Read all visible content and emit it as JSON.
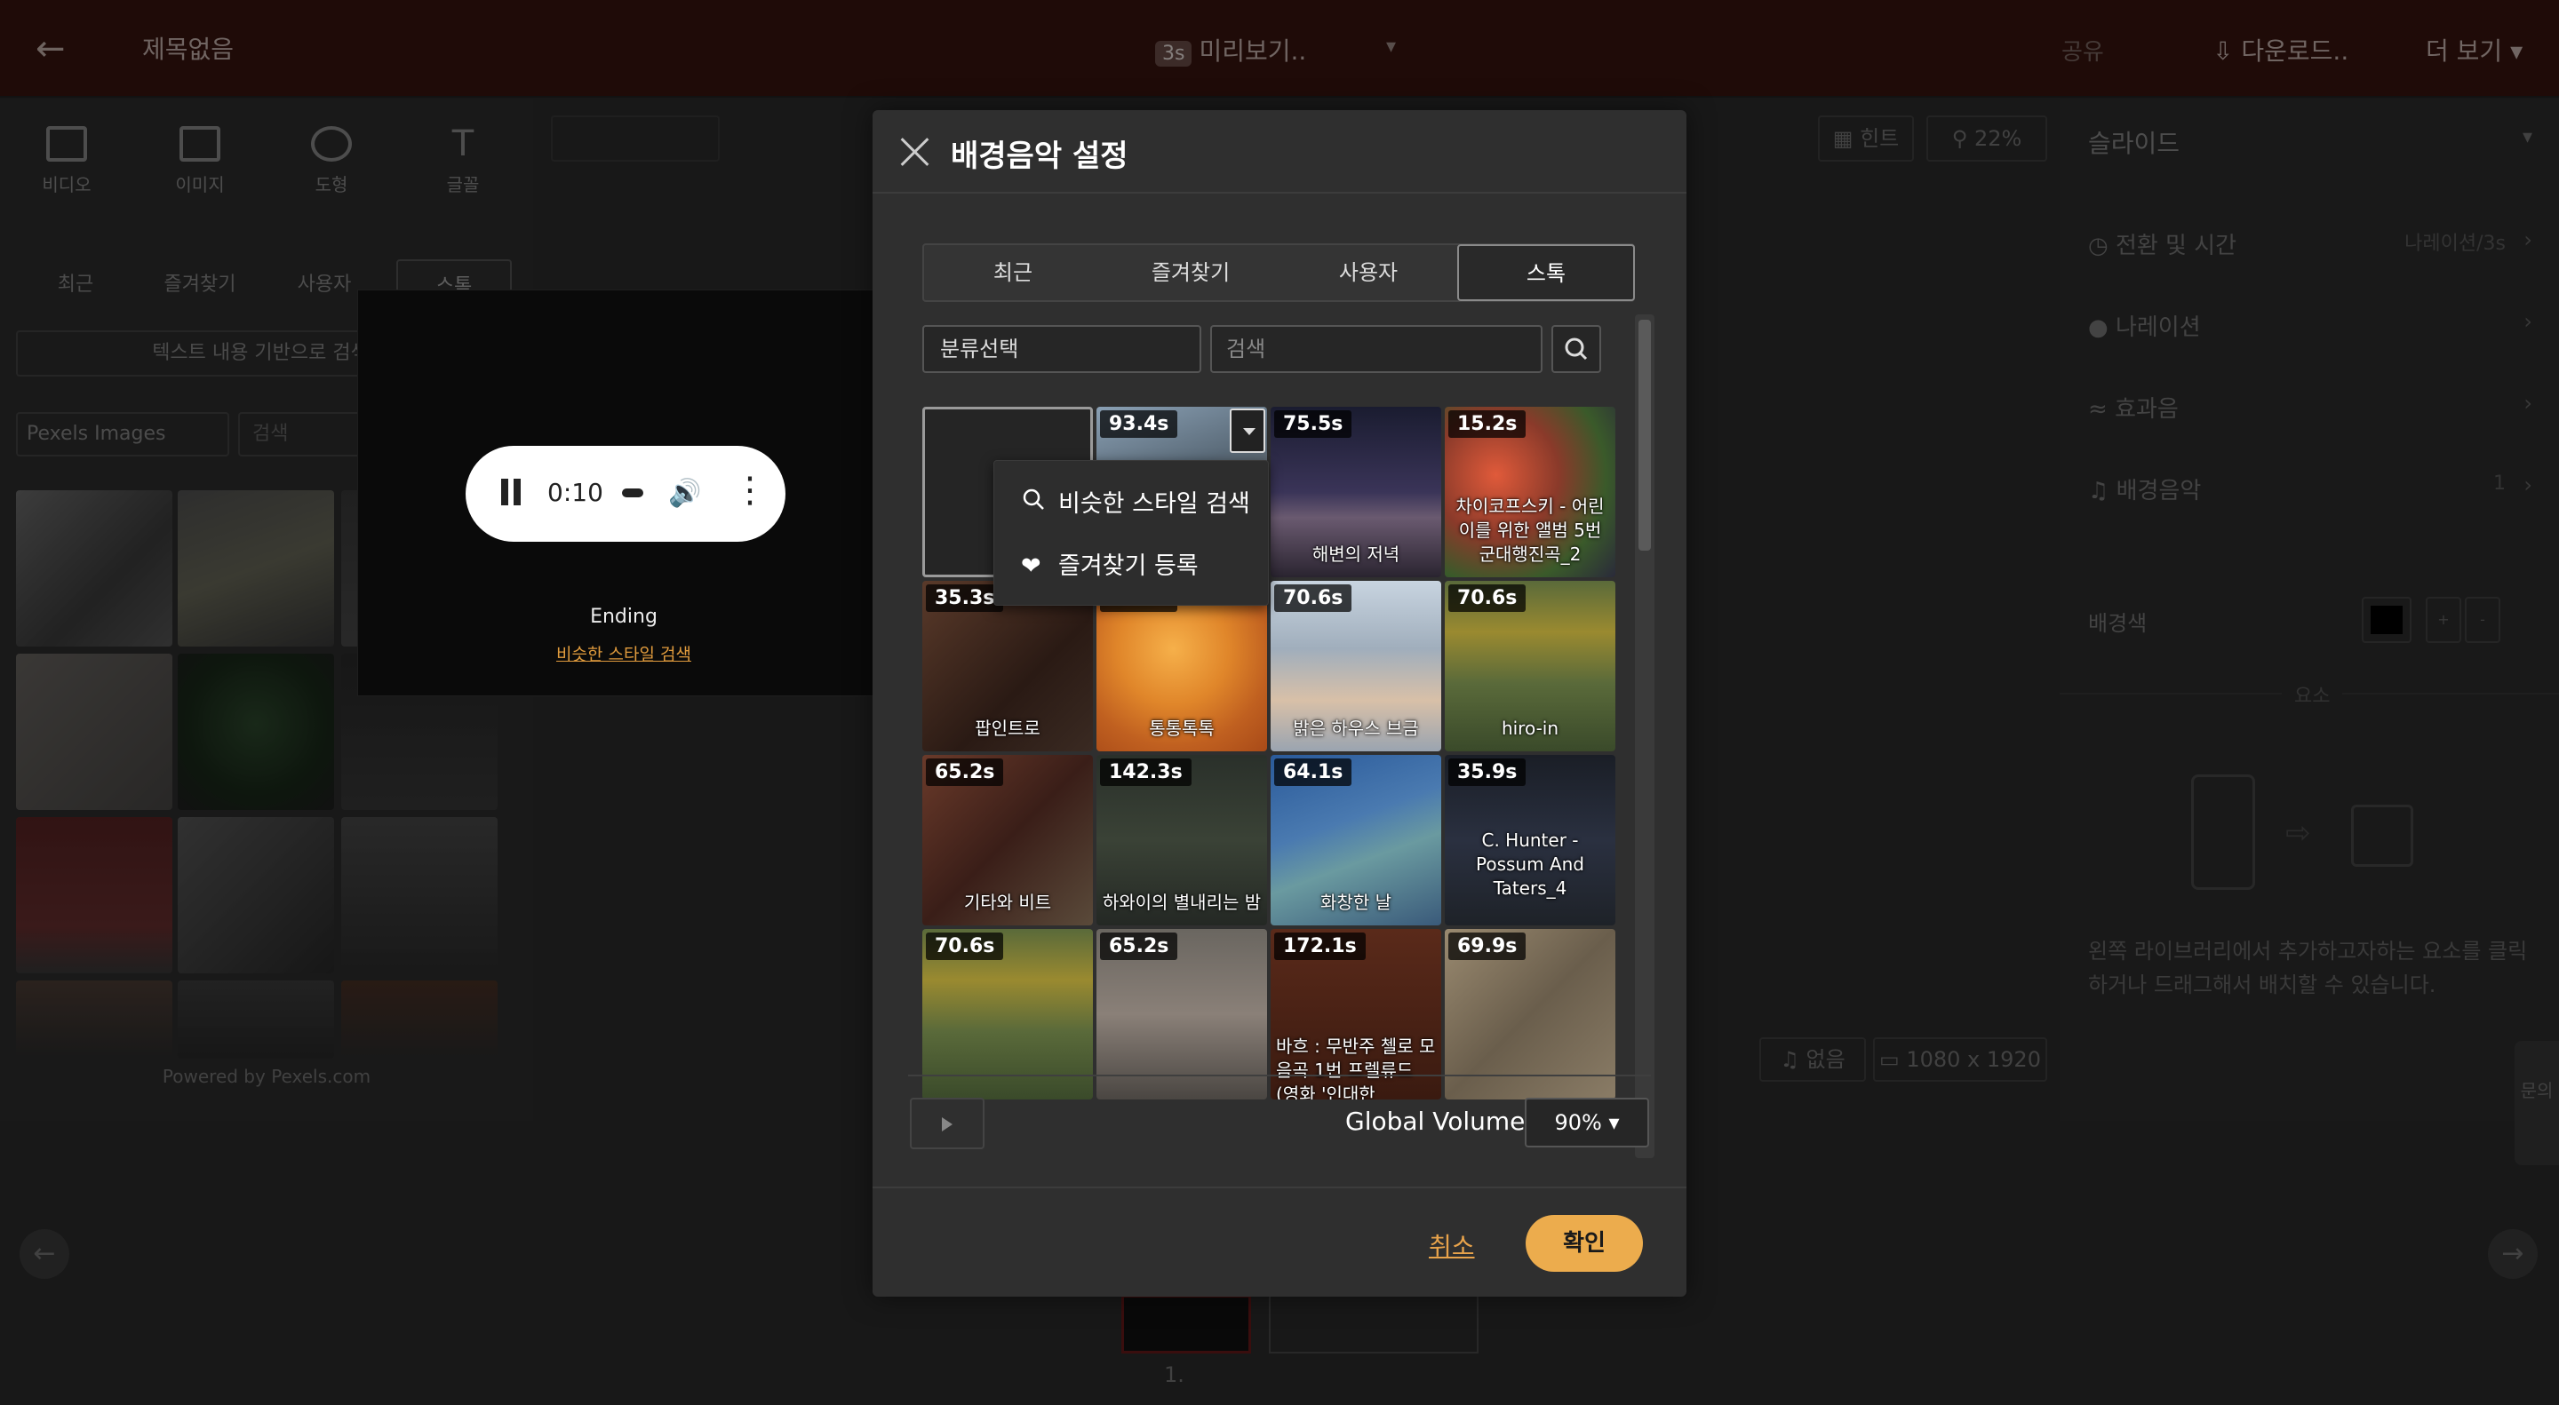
{
  "header": {
    "back_icon": "arrow-left-icon",
    "title": "제목없음",
    "preview_badge": "3s",
    "preview_label": "미리보기..",
    "share_label": "공유",
    "download_label": "다운로드..",
    "more_label": "더 보기"
  },
  "left_panel": {
    "tools": [
      {
        "label": "비디오",
        "icon": "video-icon"
      },
      {
        "label": "이미지",
        "icon": "image-icon"
      },
      {
        "label": "도형",
        "icon": "shape-icon"
      },
      {
        "label": "글꼴",
        "icon": "text-icon"
      }
    ],
    "tabs": [
      "최근",
      "즐겨찾기",
      "사용자",
      "스톡"
    ],
    "text_search": "텍스트 내용 기반으로 검색",
    "source_select": "Pexels Images",
    "search_placeholder": "검색",
    "powered": "Powered by Pexels.com"
  },
  "audio_popup": {
    "time": "0:10",
    "track_name": "Ending",
    "similar_link": "비슷한 스타일 검색"
  },
  "canvas": {
    "hint_label": "힌트",
    "zoom_label": "22%",
    "audio_label": "없음",
    "size_label": "1080 x 1920",
    "slide_number": "1."
  },
  "right_panel": {
    "title": "슬라이드",
    "rows": [
      {
        "label": "전환 및 시간",
        "value": "나레이션/3s",
        "icon": "clock-icon"
      },
      {
        "label": "나레이션",
        "value": "",
        "icon": "mic-icon"
      },
      {
        "label": "효과음",
        "value": "",
        "icon": "sound-wave-icon"
      },
      {
        "label": "배경음악",
        "value": "1",
        "icon": "music-note-icon"
      }
    ],
    "bg_color_label": "배경색",
    "element_label": "요소",
    "description": "왼쪽 라이브러리에서 추가하고자하는 요소를 클릭하거나 드래그해서 배치할 수 있습니다.",
    "side_tab": "문의"
  },
  "modal": {
    "title": "배경음악 설정",
    "tabs": [
      "최근",
      "즐겨찾기",
      "사용자",
      "스톡"
    ],
    "active_tab": "스톡",
    "category_select": "분류선택",
    "search_placeholder": "검색",
    "tracks": [
      {
        "duration": "",
        "name": ""
      },
      {
        "duration": "93.4s",
        "name": ""
      },
      {
        "duration": "75.5s",
        "name": "해변의 저녁"
      },
      {
        "duration": "15.2s",
        "name": "차이코프스키 - 어린이를 위한 앨범 5번 군대행진곡_2"
      },
      {
        "duration": "35.3s",
        "name": "팝인트로"
      },
      {
        "duration": "70.6s",
        "name": "통통톡톡"
      },
      {
        "duration": "70.6s",
        "name": "밝은 하우스 브금"
      },
      {
        "duration": "70.6s",
        "name": "hiro-in"
      },
      {
        "duration": "65.2s",
        "name": "기타와 비트"
      },
      {
        "duration": "142.3s",
        "name": "하와이의 별내리는 밤"
      },
      {
        "duration": "64.1s",
        "name": "화창한 날"
      },
      {
        "duration": "35.9s",
        "name": "C. Hunter - Possum And Taters_4"
      },
      {
        "duration": "70.6s",
        "name": ""
      },
      {
        "duration": "65.2s",
        "name": ""
      },
      {
        "duration": "172.1s",
        "name": "바흐 : 무반주 첼로 모음곡 1번 프렐류드 (영화 '인대한"
      },
      {
        "duration": "69.9s",
        "name": ""
      }
    ],
    "context_menu": [
      {
        "label": "비슷한 스타일 검색",
        "icon": "search-icon"
      },
      {
        "label": "즐겨찾기 등록",
        "icon": "heart-icon"
      }
    ],
    "global_volume_label": "Global Volume",
    "global_volume_value": "90%",
    "cancel_label": "취소",
    "confirm_label": "확인"
  }
}
